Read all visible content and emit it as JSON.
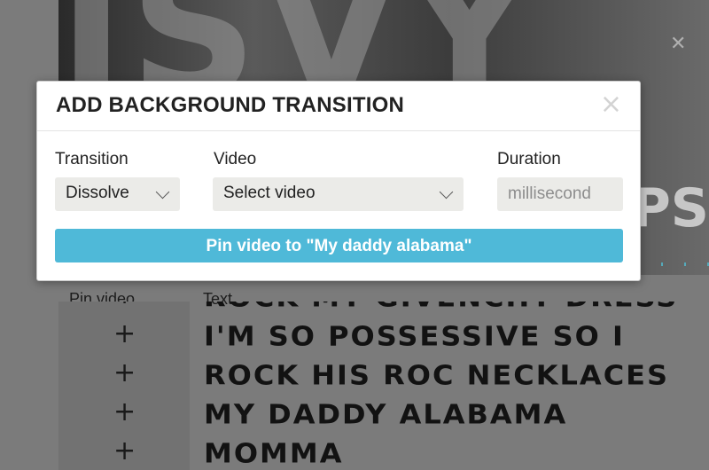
{
  "modal": {
    "title": "ADD BACKGROUND TRANSITION",
    "close_glyph": "×",
    "transition_label": "Transition",
    "transition_value": "Dissolve",
    "video_label": "Video",
    "video_value": "Select video",
    "duration_label": "Duration",
    "duration_placeholder": "millisecond",
    "pin_button_label": "Pin video to \"My daddy alabama\""
  },
  "table": {
    "headers": {
      "pin": "Pin video",
      "text": "Text"
    },
    "rows": [
      {
        "pin": "+",
        "text": "Rock my Givenchy dress"
      },
      {
        "pin": "+",
        "text": "I'm so possessive so I"
      },
      {
        "pin": "+",
        "text": "Rock his Roc necklaces"
      },
      {
        "pin": "+",
        "text": "My daddy Alabama"
      },
      {
        "pin": "+",
        "text": "Momma"
      }
    ]
  },
  "colors": {
    "accent": "#4fb9d8",
    "overlay": "#7b7b7b",
    "pin_cell": "#727272"
  },
  "icons": {
    "close": "close-icon",
    "chevron": "chevron-down-icon",
    "add": "plus-icon"
  }
}
